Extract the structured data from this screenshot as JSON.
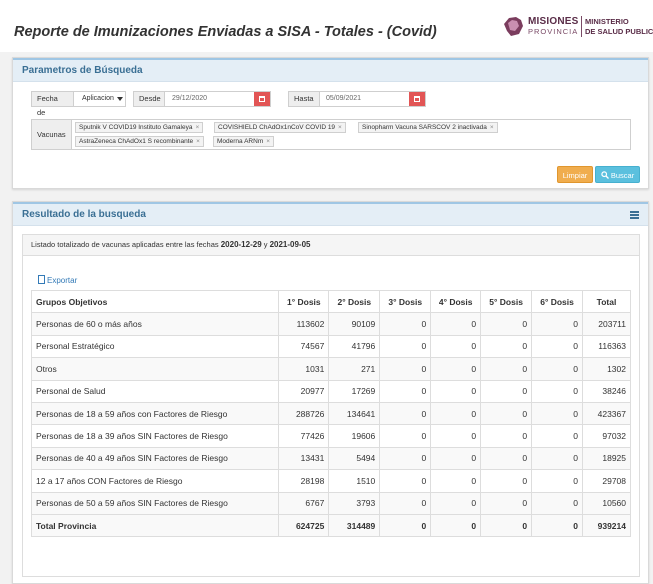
{
  "header": {
    "title": "Reporte de Imunizaciones Enviadas a SISA - Totales - (Covid)",
    "logo": {
      "line1": "MISIONES",
      "line2": "PROVINCIA",
      "line3": "MINISTERIO",
      "line4": "DE SALUD PUBLICA"
    }
  },
  "search_panel": {
    "title": "Parametros de Búsqueda",
    "fecha_label": "Fecha de",
    "fecha_select": "Aplicacion",
    "desde_label": "Desde",
    "desde_value": "29/12/2020",
    "hasta_label": "Hasta",
    "hasta_value": "05/09/2021",
    "vacunas_label": "Vacunas",
    "vacunas": [
      "Sputnik V COVID19 Instituto Gamaleya",
      "COVISHIELD ChAdOx1nCoV COVID 19",
      "Sinopharm Vacuna SARSCOV 2 inactivada",
      "AstraZeneca ChAdOx1 S recombinante",
      "Moderna ARNm"
    ],
    "tag_remove": "×",
    "clear_label": "Limpiar",
    "search_label": "Buscar"
  },
  "result_panel": {
    "title": "Resultado de la busqueda",
    "summary_prefix": "Listado totalizado de vacunas aplicadas entre las fechas ",
    "date_from": "2020-12-29",
    "summary_and": " y ",
    "date_to": "2021-09-05",
    "export_label": "Exportar",
    "columns": [
      "Grupos Objetivos",
      "1° Dosis",
      "2° Dosis",
      "3° Dosis",
      "4° Dosis",
      "5° Dosis",
      "6° Dosis",
      "Total"
    ],
    "rows": [
      [
        "Personas de 60 o más años",
        "113602",
        "90109",
        "0",
        "0",
        "0",
        "0",
        "203711"
      ],
      [
        "Personal Estratégico",
        "74567",
        "41796",
        "0",
        "0",
        "0",
        "0",
        "116363"
      ],
      [
        "Otros",
        "1031",
        "271",
        "0",
        "0",
        "0",
        "0",
        "1302"
      ],
      [
        "Personal de Salud",
        "20977",
        "17269",
        "0",
        "0",
        "0",
        "0",
        "38246"
      ],
      [
        "Personas de 18 a 59 años con Factores de Riesgo",
        "288726",
        "134641",
        "0",
        "0",
        "0",
        "0",
        "423367"
      ],
      [
        "Personas de 18 a 39 años SIN Factores de Riesgo",
        "77426",
        "19606",
        "0",
        "0",
        "0",
        "0",
        "97032"
      ],
      [
        "Personas de 40 a 49 años SIN Factores de Riesgo",
        "13431",
        "5494",
        "0",
        "0",
        "0",
        "0",
        "18925"
      ],
      [
        "12 a 17 años CON Factores de Riesgo",
        "28198",
        "1510",
        "0",
        "0",
        "0",
        "0",
        "29708"
      ],
      [
        "Personas de 50 a 59 años SIN Factores de Riesgo",
        "6767",
        "3793",
        "0",
        "0",
        "0",
        "0",
        "10560"
      ]
    ],
    "total_row": [
      "Total Provincia",
      "624725",
      "314489",
      "0",
      "0",
      "0",
      "0",
      "939214"
    ]
  }
}
